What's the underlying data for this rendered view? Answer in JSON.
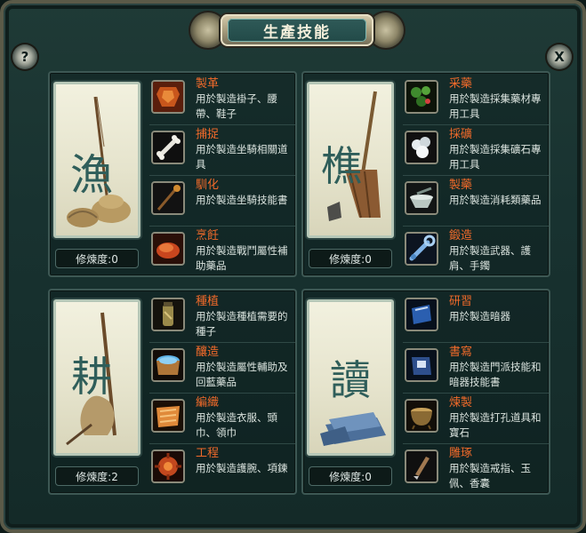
{
  "window": {
    "title": "生產技能",
    "help_label": "?",
    "close_label": "X"
  },
  "categories": [
    {
      "id": "fish",
      "emblem": "漁",
      "proficiency": "修煉度:0",
      "skills": [
        {
          "name": "製革",
          "desc": "用於製造褂子、腰帶、鞋子",
          "icon": "leather-icon"
        },
        {
          "name": "捕捉",
          "desc": "用於製造坐騎相關道具",
          "icon": "bone-icon"
        },
        {
          "name": "馴化",
          "desc": "用於製造坐騎技能書",
          "icon": "staff-icon"
        },
        {
          "name": "烹飪",
          "desc": "用於製造戰鬥屬性補助藥品",
          "icon": "cooked-meat-icon"
        }
      ]
    },
    {
      "id": "wood",
      "emblem": "樵",
      "proficiency": "修煉度:0",
      "skills": [
        {
          "name": "采藥",
          "desc": "用於製造採集藥材專用工具",
          "icon": "herb-icon"
        },
        {
          "name": "採礦",
          "desc": "用於製造採集礦石專用工具",
          "icon": "ore-icon"
        },
        {
          "name": "製藥",
          "desc": "用於製造消耗類藥品",
          "icon": "mortar-icon"
        },
        {
          "name": "鍛造",
          "desc": "用於製造武器、護肩、手鐲",
          "icon": "wrench-icon"
        }
      ]
    },
    {
      "id": "farm",
      "emblem": "耕",
      "proficiency": "修煉度:2",
      "skills": [
        {
          "name": "種植",
          "desc": "用於製造種植需要的種子",
          "icon": "seed-bottle-icon"
        },
        {
          "name": "釀造",
          "desc": "用於製造屬性輔助及回藍藥品",
          "icon": "brew-barrel-icon"
        },
        {
          "name": "編織",
          "desc": "用於製造衣服、頭巾、領巾",
          "icon": "cloth-icon"
        },
        {
          "name": "工程",
          "desc": "用於製造護腕、項鍊",
          "icon": "gear-bracer-icon"
        }
      ]
    },
    {
      "id": "read",
      "emblem": "讀",
      "proficiency": "修煉度:0",
      "skills": [
        {
          "name": "研習",
          "desc": "用於製造暗器",
          "icon": "blue-book-icon"
        },
        {
          "name": "書寫",
          "desc": "用於製造門派技能和暗器技能書",
          "icon": "skill-book-icon"
        },
        {
          "name": "煉製",
          "desc": "用於製造打孔道具和寶石",
          "icon": "cauldron-icon"
        },
        {
          "name": "雕琢",
          "desc": "用於製造戒指、玉佩、香囊",
          "icon": "chisel-icon"
        }
      ]
    }
  ],
  "colors": {
    "skill_name": "#f06a2a",
    "skill_desc": "#dbe4df",
    "panel_bg": "#183230",
    "card_bg": "#e6e4cd",
    "calligraphy": "#2f5e5a"
  }
}
